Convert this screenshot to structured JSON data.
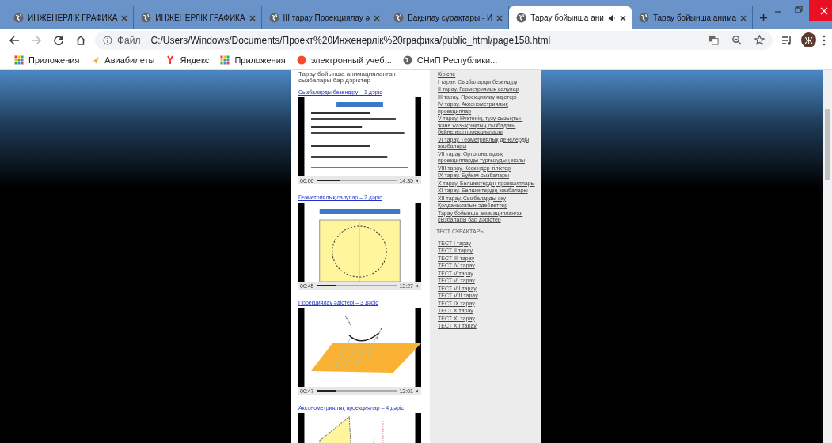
{
  "tabs": [
    {
      "title": "ИНЖЕНЕРЛІК ГРАФИКА",
      "selected": false,
      "audio": false
    },
    {
      "title": "ИНЖЕНЕРЛІК ГРАФИКА",
      "selected": false,
      "audio": false
    },
    {
      "title": "III тарау Проекциялау ә",
      "selected": false,
      "audio": false
    },
    {
      "title": "Бақылау сұрақтары - И",
      "selected": false,
      "audio": false
    },
    {
      "title": "Тарау бойынша ани",
      "selected": true,
      "audio": true
    },
    {
      "title": "Тарау бойынша анима",
      "selected": false,
      "audio": false
    }
  ],
  "toolbar": {
    "scheme": "Файл",
    "url": "C:/Users/Windows/Documents/Проект%20Инженерлік%20графика/public_html/page158.html",
    "avatar": "Ж"
  },
  "bookmarks": [
    {
      "label": "Приложения",
      "kind": "apps"
    },
    {
      "label": "Авиабилеты",
      "kind": "plane"
    },
    {
      "label": "Яндекс",
      "kind": "yandex"
    },
    {
      "label": "Приложения",
      "kind": "apps"
    },
    {
      "label": "электронный учеб...",
      "kind": "dot"
    },
    {
      "label": "СНиП Республики...",
      "kind": "globe"
    }
  ],
  "page": {
    "heading": "Тарау бойынша анимацияланған сызбалары бар дәрістер",
    "videos": [
      {
        "link": "Сызбаларды безендіру – 1 дәріс",
        "elapsed": "00:00",
        "duration": "14:35",
        "level": 0.3
      },
      {
        "link": "Геометриялық салулар – 2 дәріс",
        "elapsed": "00:45",
        "duration": "13:27",
        "level": 0.25
      },
      {
        "link": "Проекциялау әдістері – 3 дәріс",
        "elapsed": "00:47",
        "duration": "12:01",
        "level": 0.25
      },
      {
        "link": "Аксонометриялық проекциялар – 4 дәріс"
      }
    ],
    "sidebar": {
      "chapters": [
        "Кіріспе",
        "I тарау. Сызбаларды безендіру",
        "II тарау. Геометриялық салулар",
        "III тарау. Проекциялау әдістері",
        "IV тарау. Аксонометриялық проекциялар",
        "V тарау. Нүктенің, түзу сызықтың және жазықтықтың сызбадағы бейнелері проекциялары",
        "VI тарау. Геометриялық денелердің жазбалары",
        "VII тарау. Ортогональдық проекцияларды тұрғызудың жолы",
        "VIII тарау. Кескіндер тіліктер",
        "IX тарау. Бұйым сызбалары",
        "X тарау. Бөлшектердің проекциялары",
        "XI тарау. Бөлшектердің жазбалары",
        "XII тарау. Сызбаларды оқу",
        "Қолданылатын әдебиеттер",
        "Тарау бойынша анимацияланған сызбалары бар дәрістер"
      ],
      "tests_title": "ТЕСТ СҰРАҚТАРЫ",
      "tests": [
        "ТЕСТ I тарау",
        "ТЕСТ II тарау",
        "ТЕСТ III тарау",
        "ТЕСТ IV тарау",
        "ТЕСТ V тарау",
        "ТЕСТ VI тарау",
        "ТЕСТ VII тарау",
        "ТЕСТ VIII тарау",
        "ТЕСТ IX тарау",
        "ТЕСТ X тарау",
        "ТЕСТ XI тарау",
        "ТЕСТ XII тарау"
      ]
    }
  }
}
